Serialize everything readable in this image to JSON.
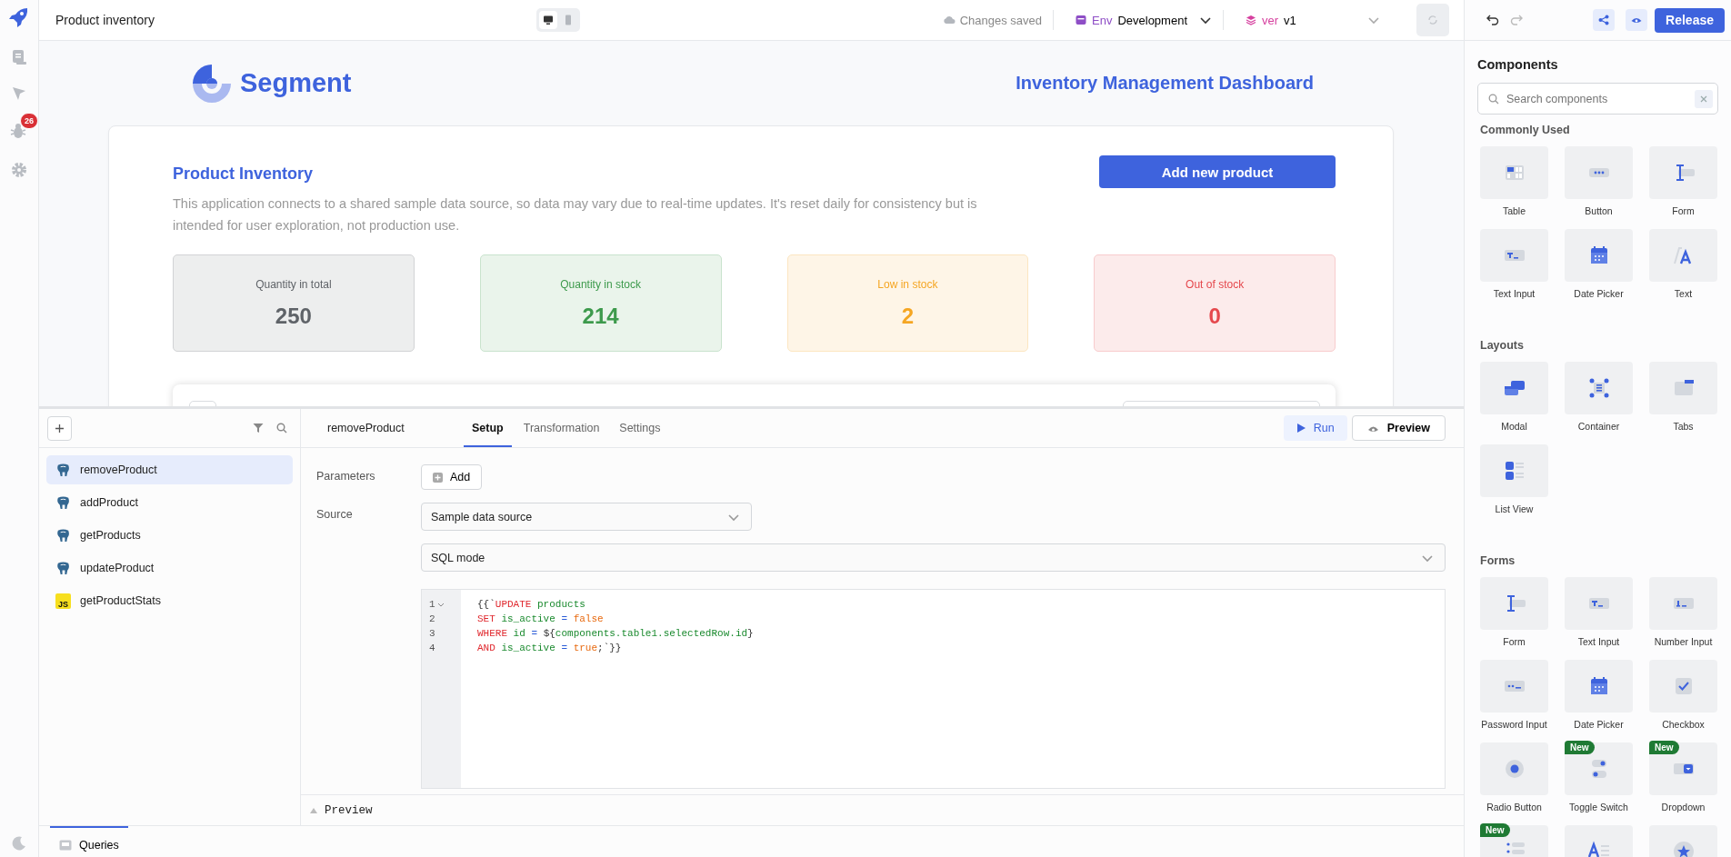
{
  "app": {
    "title": "Product inventory",
    "device_modes": [
      {
        "kind": "desktop",
        "selected": true
      },
      {
        "kind": "mobile",
        "selected": false
      }
    ],
    "save_status": "Changes saved",
    "env": {
      "label": "Env",
      "value": "Development"
    },
    "version": {
      "label": "ver",
      "value": "v1"
    },
    "release": "Release"
  },
  "rail": {
    "badge": "26"
  },
  "canvas": {
    "brand": "Segment",
    "heading": "Inventory Management Dashboard",
    "section_title": "Product Inventory",
    "description": "This application connects to a shared sample data source, so data may vary due to real-time updates. It's reset daily for consistency but is intended for user exploration, not production use.",
    "add_button": "Add new product",
    "stats": [
      {
        "label": "Quantity in total",
        "value": "250",
        "color": "#5f6368"
      },
      {
        "label": "Quantity in stock",
        "value": "214",
        "color": "#3d9a4c"
      },
      {
        "label": "Low in stock",
        "value": "2",
        "color": "#f5a623"
      },
      {
        "label": "Out of stock",
        "value": "0",
        "color": "#e5484d"
      }
    ]
  },
  "queries": {
    "items": [
      {
        "name": "removeProduct",
        "kind": "postgres",
        "selected": true
      },
      {
        "name": "addProduct",
        "kind": "postgres",
        "selected": false
      },
      {
        "name": "getProducts",
        "kind": "postgres",
        "selected": false
      },
      {
        "name": "updateProduct",
        "kind": "postgres",
        "selected": false
      },
      {
        "name": "getProductStats",
        "kind": "js",
        "icon_text": "JS",
        "selected": false
      }
    ],
    "footer_tab": "Queries"
  },
  "editor": {
    "query_name": "removeProduct",
    "tabs": [
      {
        "label": "Setup",
        "selected": true
      },
      {
        "label": "Transformation",
        "selected": false
      },
      {
        "label": "Settings",
        "selected": false
      }
    ],
    "run": "Run",
    "preview": "Preview",
    "parameters_label": "Parameters",
    "add": "Add",
    "source_label": "Source",
    "source": "Sample data source",
    "mode": "SQL mode",
    "code": [
      {
        "number": "1",
        "foldable": true,
        "tokens": [
          {
            "text": "{{`",
            "kind": "plain"
          },
          {
            "text": "UPDATE",
            "kind": "kw"
          },
          {
            "text": " products",
            "kind": "id"
          }
        ]
      },
      {
        "number": "2",
        "foldable": false,
        "tokens": [
          {
            "text": "SET",
            "kind": "kw"
          },
          {
            "text": " is_active",
            "kind": "id"
          },
          {
            "text": " = ",
            "kind": "op"
          },
          {
            "text": "false",
            "kind": "lit"
          }
        ]
      },
      {
        "number": "3",
        "foldable": false,
        "tokens": [
          {
            "text": "WHERE",
            "kind": "kw"
          },
          {
            "text": " id",
            "kind": "id"
          },
          {
            "text": " = ",
            "kind": "op"
          },
          {
            "text": "${",
            "kind": "plain"
          },
          {
            "text": "components.table1.selectedRow.id",
            "kind": "id"
          },
          {
            "text": "}",
            "kind": "plain"
          }
        ]
      },
      {
        "number": "4",
        "foldable": false,
        "tokens": [
          {
            "text": "AND",
            "kind": "kw"
          },
          {
            "text": " is_active",
            "kind": "id"
          },
          {
            "text": " = ",
            "kind": "op"
          },
          {
            "text": "true",
            "kind": "lit"
          },
          {
            "text": ";`}}",
            "kind": "plain"
          }
        ]
      }
    ],
    "preview_bar": "Preview"
  },
  "components": {
    "title": "Components",
    "search_placeholder": "Search components",
    "sections": [
      {
        "title": "Commonly Used",
        "items": [
          {
            "label": "Table",
            "kind": "table"
          },
          {
            "label": "Button",
            "kind": "button"
          },
          {
            "label": "Form",
            "kind": "form"
          },
          {
            "label": "Text Input",
            "kind": "text-input"
          },
          {
            "label": "Date Picker",
            "kind": "date-picker"
          },
          {
            "label": "Text",
            "kind": "text"
          }
        ]
      },
      {
        "title": "Layouts",
        "items": [
          {
            "label": "Modal",
            "kind": "modal"
          },
          {
            "label": "Container",
            "kind": "container"
          },
          {
            "label": "Tabs",
            "kind": "tabs"
          },
          {
            "label": "List View",
            "kind": "list-view"
          }
        ]
      },
      {
        "title": "Forms",
        "items": [
          {
            "label": "Form",
            "kind": "form"
          },
          {
            "label": "Text Input",
            "kind": "text-input"
          },
          {
            "label": "Number Input",
            "kind": "number-input"
          },
          {
            "label": "Password Input",
            "kind": "password-input"
          },
          {
            "label": "Date Picker",
            "kind": "date-picker"
          },
          {
            "label": "Checkbox",
            "kind": "checkbox"
          },
          {
            "label": "Radio Button",
            "kind": "radio"
          },
          {
            "label": "Toggle Switch",
            "kind": "toggle",
            "badge": "New"
          },
          {
            "label": "Dropdown",
            "kind": "dropdown",
            "badge": "New"
          },
          {
            "kind": "list",
            "badge": "New"
          },
          {
            "kind": "rich-text"
          },
          {
            "kind": "rating"
          }
        ]
      }
    ]
  }
}
